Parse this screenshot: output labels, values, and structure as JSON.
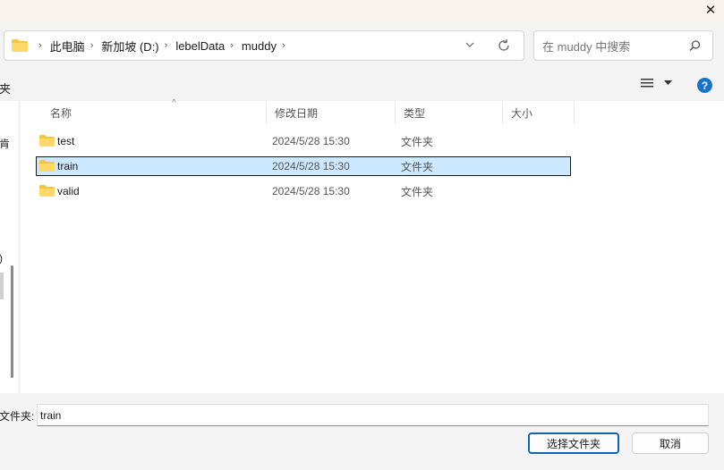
{
  "window": {
    "close_glyph": "✕"
  },
  "address": {
    "breadcrumbs": [
      {
        "label": "此电脑"
      },
      {
        "label": "新加坡 (D:)"
      },
      {
        "label": "lebelData"
      },
      {
        "label": "muddy"
      }
    ],
    "separator": "›",
    "dropdown_glyph": "⌄"
  },
  "search": {
    "placeholder": "在 muddy 中搜索"
  },
  "toolbar": {
    "left_fragment": "夹",
    "help_glyph": "?"
  },
  "nav": {
    "fragments": [
      "肯",
      ")"
    ]
  },
  "columns": {
    "name": "名称",
    "date": "修改日期",
    "type": "类型",
    "size": "大小",
    "sort_glyph": "^"
  },
  "files": [
    {
      "name": "test",
      "date": "2024/5/28 15:30",
      "type": "文件夹",
      "size": "",
      "selected": false
    },
    {
      "name": "train",
      "date": "2024/5/28 15:30",
      "type": "文件夹",
      "size": "",
      "selected": true
    },
    {
      "name": "valid",
      "date": "2024/5/28 15:30",
      "type": "文件夹",
      "size": "",
      "selected": false
    }
  ],
  "footer": {
    "folder_label": "文件夹:",
    "folder_value": "train",
    "select_button": "选择文件夹",
    "cancel_button": "取消"
  },
  "colors": {
    "accent": "#0a64b8",
    "selection": "#cce8ff",
    "folder": "#f4c542",
    "help": "#1b73c9"
  }
}
